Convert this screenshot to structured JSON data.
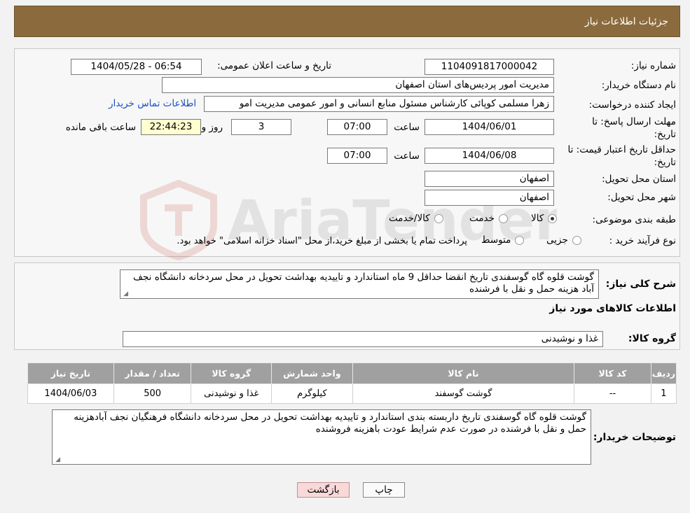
{
  "header": {
    "title": "جزئیات اطلاعات نیاز"
  },
  "form": {
    "need_number_label": "شماره نیاز:",
    "need_number": "1104091817000042",
    "announce_label": "تاریخ و ساعت اعلان عمومی:",
    "announce_value": "1404/05/28 - 06:54",
    "buyer_org_label": "نام دستگاه خریدار:",
    "buyer_org": "مدیریت امور پردیس‌های استان اصفهان",
    "requester_label": "ایجاد کننده درخواست:",
    "requester": "زهرا مسلمی کوپائی کارشناس مسئول منابع انسانی و امور عمومی مدیریت امو",
    "contact_link": "اطلاعات تماس خریدار",
    "deadline_label_1": "مهلت ارسال پاسخ: تا",
    "deadline_label_2": "تاریخ:",
    "deadline_date": "1404/06/01",
    "time_label": "ساعت",
    "deadline_time": "07:00",
    "days_value": "3",
    "days_label": "روز و",
    "remaining_value": "22:44:23",
    "remaining_label": "ساعت باقی مانده",
    "validity_label_1": "حداقل تاریخ اعتبار قیمت: تا",
    "validity_label_2": "تاریخ:",
    "validity_date": "1404/06/08",
    "validity_time": "07:00",
    "province_label": "استان محل تحویل:",
    "province": "اصفهان",
    "city_label": "شهر محل تحویل:",
    "city": "اصفهان",
    "category_label": "طبقه بندی موضوعی:",
    "category_options": [
      "کالا",
      "خدمت",
      "کالا/خدمت"
    ],
    "category_selected": "کالا",
    "process_label": "نوع فرآیند خرید :",
    "process_options": [
      "جزیی",
      "متوسط"
    ],
    "process_note": "پرداخت تمام یا بخشی از مبلغ خرید،از محل \"اسناد خزانه اسلامی\" خواهد بود."
  },
  "description": {
    "label": "شرح کلی نیاز:",
    "text": "گوشت قلوه گاه گوسفندی تاریخ انقضا حداقل 9 ماه  استاندارد و تاییدیه بهداشت تحویل در محل سردخانه دانشگاه نجف آباد هزینه حمل و نقل با فرشنده"
  },
  "goods": {
    "section_title": "اطلاعات کالاهای مورد نیاز",
    "group_label": "گروه کالا:",
    "group_value": "غذا و نوشیدنی",
    "columns": [
      "ردیف",
      "کد کالا",
      "نام کالا",
      "واحد شمارش",
      "گروه کالا",
      "تعداد / مقدار",
      "تاریخ نیاز"
    ],
    "rows": [
      [
        "1",
        "--",
        "گوشت گوسفند",
        "کیلوگرم",
        "غذا و نوشیدنی",
        "500",
        "1404/06/03"
      ]
    ]
  },
  "buyer_notes": {
    "label": "توضیحات خریدار:",
    "text": "گوشت قلوه گاه گوسفندی تاریخ داربسته بندی استاندارد و تاییدیه بهداشت تحویل در محل سردخانه دانشگاه فرهنگیان نجف آبادهزینه حمل و نقل با فرشنده در صورت عدم شرایط عودت باهزینه فروشنده"
  },
  "buttons": {
    "print": "چاپ",
    "back": "بازگشت"
  },
  "colors": {
    "header": "#8b6b3d",
    "table_header": "#a0a0a0",
    "link": "#1d4fc2",
    "back_button": "#f8d8d8"
  }
}
